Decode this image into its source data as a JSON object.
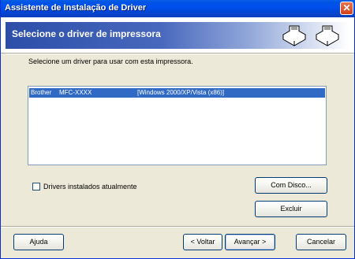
{
  "window": {
    "title": "Assistente de Instalação de Driver",
    "close_glyph": "✕"
  },
  "header": {
    "title": "Selecione o driver de impressora",
    "icons": [
      "printer-icon",
      "printer-icon"
    ]
  },
  "instruction": "Selecione um driver para usar com esta impressora.",
  "drivers": [
    {
      "brand": "Brother",
      "model": "MFC-XXXX",
      "platform": "[Windows 2000/XP/Vista (x86)]",
      "selected": true
    }
  ],
  "checkbox": {
    "label": "Drivers instalados atualmente",
    "checked": false
  },
  "buttons": {
    "have_disk": "Com Disco...",
    "delete": "Excluir",
    "help": "Ajuda",
    "back": "< Voltar",
    "next": "Avançar >",
    "cancel": "Cancelar"
  },
  "colors": {
    "title_bar": "#0054e3",
    "selection": "#316ac5",
    "dialog_bg": "#ece9d8",
    "header_band": "#2c4ea8"
  }
}
